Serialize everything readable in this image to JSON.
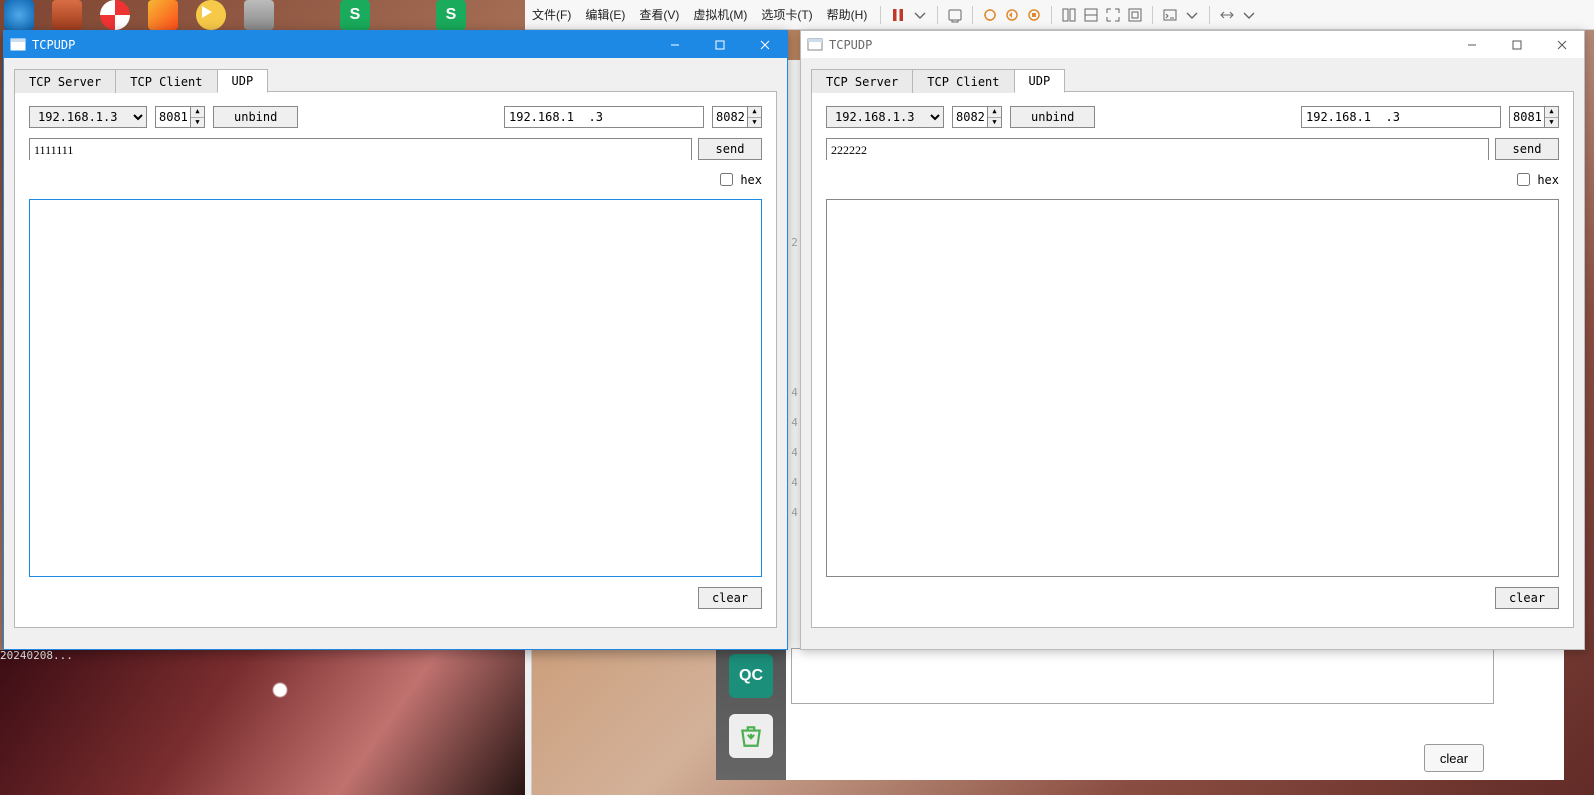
{
  "desktop_timestamp_fragment": "20240208...",
  "vm_menu": {
    "items": [
      "文件(F)",
      "编辑(E)",
      "查看(V)",
      "虚拟机(M)",
      "选项卡(T)",
      "帮助(H)"
    ]
  },
  "under_clear_label": "clear",
  "qc_label": "QC",
  "gutter": {
    "top": "2",
    "lines": [
      "4",
      "4",
      "4",
      "4",
      "4"
    ]
  },
  "windows": [
    {
      "title": "TCPUDP",
      "active": true,
      "tabs": [
        "TCP Server",
        "TCP Client",
        "UDP"
      ],
      "active_tab": 2,
      "local_ip_options": [
        "192.168.1.3"
      ],
      "local_ip": "192.168.1.3",
      "local_port": "8081",
      "bind_button": "unbind",
      "remote_ip": "192.168.1  .3",
      "remote_port": "8082",
      "message": "1111111",
      "send_button": "send",
      "hex_label": "hex",
      "hex_checked": false,
      "clear_button": "clear"
    },
    {
      "title": "TCPUDP",
      "active": false,
      "tabs": [
        "TCP Server",
        "TCP Client",
        "UDP"
      ],
      "active_tab": 2,
      "local_ip_options": [
        "192.168.1.3"
      ],
      "local_ip": "192.168.1.3",
      "local_port": "8082",
      "bind_button": "unbind",
      "remote_ip": "192.168.1  .3",
      "remote_port": "8081",
      "message": "222222",
      "send_button": "send",
      "hex_label": "hex",
      "hex_checked": false,
      "clear_button": "clear"
    }
  ]
}
